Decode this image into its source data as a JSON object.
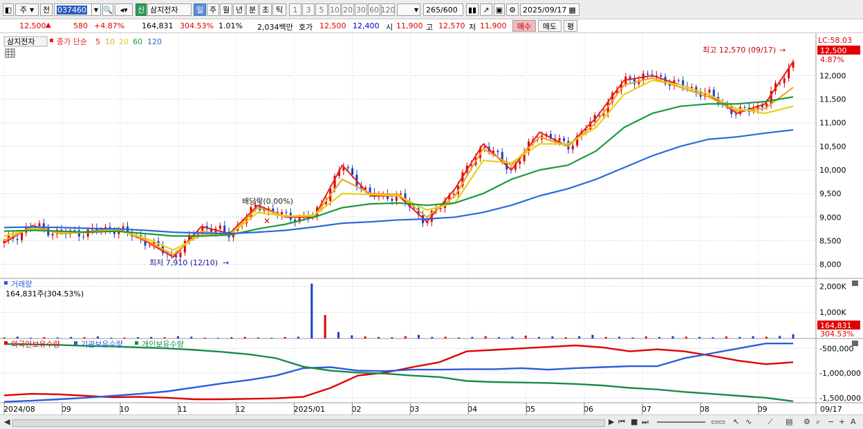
{
  "toolbar": {
    "type_label": "주",
    "prev_label": "전",
    "code": "037460",
    "badge": "신",
    "stock_name": "삼지전자",
    "periods": [
      "일",
      "주",
      "월",
      "년",
      "분",
      "초",
      "틱"
    ],
    "active_period": "일",
    "minutes": [
      "1",
      "3",
      "5",
      "10",
      "20",
      "30",
      "60",
      "120"
    ],
    "count": "265",
    "count_total": "/600",
    "date": "2025/09/17"
  },
  "quote": {
    "price": "12,500",
    "change_arrow": "▲",
    "change": "580",
    "change_pct": "+4.87%",
    "volume": "164,831",
    "volume_pct": "304.53%",
    "turnover": "1.01%",
    "amount": "2,034백만",
    "bid_label": "호가",
    "ask_price": "12,500",
    "bid_price": "12,400",
    "open_label": "시",
    "open": "11,900",
    "high_label": "고",
    "high": "12,570",
    "low_label": "저",
    "low": "11,900",
    "buy_label": "매수",
    "sell_label": "매도",
    "avg_label": "평"
  },
  "price_pane": {
    "stock_tag": "삼지전자",
    "ma_title": "종가 단순",
    "ma_list": [
      {
        "period": "5",
        "color": "#e8211d"
      },
      {
        "period": "10",
        "color": "#f2a42a"
      },
      {
        "period": "20",
        "color": "#e6d214"
      },
      {
        "period": "60",
        "color": "#1a9a3a"
      },
      {
        "period": "120",
        "color": "#2a6ad8"
      }
    ],
    "lc_label": "LC:58.03",
    "current_price_tag": "12,500",
    "current_pct_tag": "4.87%",
    "high_annotation": "최고 12,570 (09/17)",
    "low_annotation": "최저 7,910 (12/10)",
    "dividend_annotation": "배당락(0.00%)"
  },
  "volume_pane": {
    "title": "거래량",
    "info": "164,831주(304.53%)",
    "tag_value": "164,831",
    "tag_pct": "304.53%"
  },
  "holding_pane": {
    "legends": [
      {
        "label": "외국인보유수량",
        "color": "#e00000"
      },
      {
        "label": "기관보유수량",
        "color": "#2a5dd8"
      },
      {
        "label": "개인보유수량",
        "color": "#1a8a4a"
      }
    ]
  },
  "chart_data": [
    {
      "type": "line",
      "title": "삼지전자 종가 단순 이동평균",
      "ylim": [
        7700,
        12900
      ],
      "y_ticks": [
        "8,000",
        "8,500",
        "9,000",
        "9,500",
        "10,000",
        "10,500",
        "11,000",
        "11,500",
        "12,000"
      ],
      "x": [
        "2024/08",
        "09",
        "10",
        "11",
        "12",
        "2025/01",
        "02",
        "03",
        "04",
        "05",
        "06",
        "07",
        "08",
        "09"
      ],
      "series": [
        {
          "name": "5",
          "values": [
            8450,
            8820,
            8650,
            8690,
            8760,
            8500,
            8150,
            8800,
            8650,
            9250,
            9000,
            9000,
            10100,
            9450,
            9450,
            8900,
            9600,
            10550,
            10000,
            10800,
            10500,
            11100,
            11900,
            12000,
            11800,
            11600,
            11200,
            11400,
            12300
          ]
        },
        {
          "name": "10",
          "values": [
            8500,
            8800,
            8650,
            8680,
            8750,
            8520,
            8200,
            8700,
            8620,
            9200,
            9020,
            9020,
            9800,
            9500,
            9480,
            9000,
            9450,
            10450,
            10100,
            10700,
            10500,
            11000,
            11800,
            11950,
            11750,
            11550,
            11250,
            11300,
            11750
          ]
        },
        {
          "name": "20",
          "values": [
            8600,
            8750,
            8680,
            8680,
            8720,
            8560,
            8300,
            8620,
            8620,
            9100,
            9020,
            9040,
            9500,
            9480,
            9450,
            9150,
            9300,
            10200,
            10150,
            10550,
            10550,
            10900,
            11600,
            11900,
            11800,
            11600,
            11300,
            11200,
            11350
          ]
        },
        {
          "name": "60",
          "values": [
            8700,
            8720,
            8700,
            8680,
            8700,
            8650,
            8600,
            8600,
            8620,
            8750,
            8850,
            9000,
            9200,
            9280,
            9300,
            9250,
            9300,
            9500,
            9800,
            10000,
            10100,
            10400,
            10900,
            11200,
            11350,
            11400,
            11400,
            11450,
            11550
          ]
        },
        {
          "name": "120",
          "values": [
            8780,
            8790,
            8780,
            8760,
            8750,
            8720,
            8680,
            8660,
            8650,
            8680,
            8720,
            8790,
            8870,
            8900,
            8940,
            8960,
            9000,
            9100,
            9250,
            9450,
            9600,
            9800,
            10050,
            10300,
            10500,
            10650,
            10700,
            10780,
            10850
          ]
        }
      ]
    },
    {
      "type": "bar",
      "title": "거래량",
      "ylim": [
        0,
        2300000
      ],
      "y_ticks": [
        "1,000K",
        "2,000K"
      ],
      "values": [
        40000,
        70000,
        30000,
        50000,
        40000,
        60000,
        50000,
        80000,
        30000,
        40000,
        50000,
        60000,
        45000,
        90000,
        70000,
        35000,
        25000,
        50000,
        60000,
        40000,
        30000,
        55000,
        70000,
        2100000,
        900000,
        250000,
        120000,
        80000,
        60000,
        50000,
        90000,
        140000,
        60000,
        70000,
        40000,
        60000,
        90000,
        50000,
        70000,
        110000,
        60000,
        80000,
        50000,
        90000,
        140000,
        60000,
        70000,
        40000,
        80000,
        60000,
        90000,
        70000,
        60000,
        50000,
        80000,
        60000,
        90000,
        70000,
        100000,
        164831
      ]
    },
    {
      "type": "line",
      "title": "보유수량",
      "ylim": [
        -1600000,
        -300000
      ],
      "y_ticks": [
        "-500,000",
        "-1,000,000",
        "-1,500,000"
      ],
      "series": [
        {
          "name": "외국인보유수량",
          "values": [
            -1450000,
            -1420000,
            -1430000,
            -1460000,
            -1490000,
            -1480000,
            -1500000,
            -1530000,
            -1530000,
            -1520000,
            -1510000,
            -1480000,
            -1300000,
            -1050000,
            -990000,
            -880000,
            -780000,
            -560000,
            -530000,
            -500000,
            -470000,
            -440000,
            -480000,
            -560000,
            -520000,
            -560000,
            -650000,
            -750000,
            -820000,
            -780000
          ]
        },
        {
          "name": "기관보유수량",
          "values": [
            -1580000,
            -1560000,
            -1530000,
            -1500000,
            -1460000,
            -1420000,
            -1370000,
            -1290000,
            -1210000,
            -1140000,
            -1050000,
            -900000,
            -880000,
            -950000,
            -960000,
            -930000,
            -930000,
            -920000,
            -920000,
            -900000,
            -930000,
            -900000,
            -880000,
            -860000,
            -860000,
            -700000,
            -600000,
            -500000,
            -400000,
            -400000
          ]
        },
        {
          "name": "개인보유수량",
          "values": [
            -410000,
            -420000,
            -430000,
            -450000,
            -460000,
            -480000,
            -500000,
            -530000,
            -570000,
            -620000,
            -700000,
            -870000,
            -950000,
            -990000,
            -1010000,
            -1050000,
            -1080000,
            -1160000,
            -1180000,
            -1190000,
            -1200000,
            -1220000,
            -1250000,
            -1300000,
            -1330000,
            -1380000,
            -1420000,
            -1460000,
            -1500000,
            -1570000
          ]
        }
      ]
    }
  ]
}
